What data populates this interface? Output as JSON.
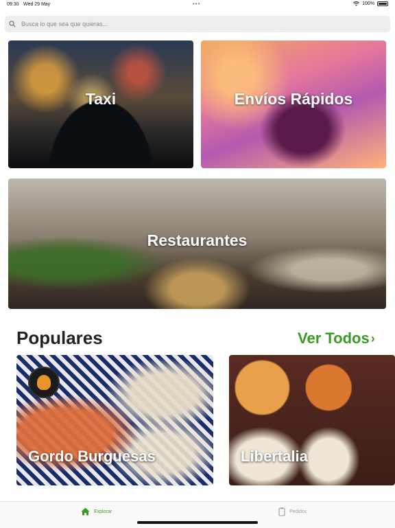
{
  "status_bar": {
    "time": "09:30",
    "date": "Wed 29 May",
    "battery": "100%"
  },
  "search": {
    "placeholder": "Busca lo que sea que quieras..."
  },
  "categories": [
    {
      "label": "Taxi"
    },
    {
      "label": "Envíos Rápidos"
    },
    {
      "label": "Restaurantes"
    }
  ],
  "populares": {
    "title": "Populares",
    "see_all": "Ver Todos",
    "items": [
      {
        "name": "Gordo Burguesas"
      },
      {
        "name": "Libertalia"
      }
    ]
  },
  "tabbar": {
    "explore": "Explorar",
    "orders": "Pedidos"
  },
  "colors": {
    "accent": "#3a9a22"
  },
  "icons": [
    "search-icon",
    "wifi-icon",
    "battery-icon",
    "chevron-right-icon",
    "home-icon",
    "receipt-icon"
  ]
}
